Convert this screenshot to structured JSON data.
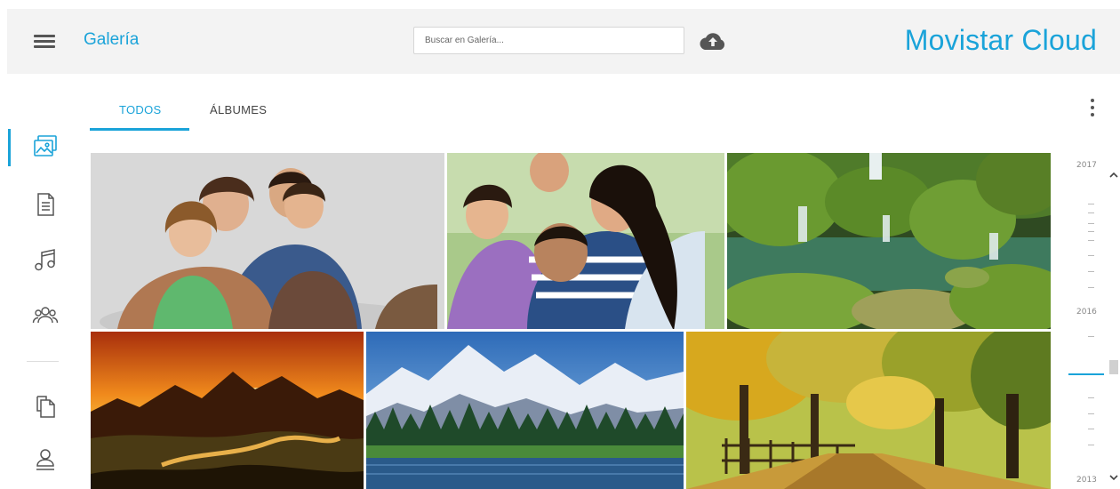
{
  "header": {
    "section_title": "Galería",
    "search_placeholder": "Buscar en Galería...",
    "brand": "Movistar Cloud"
  },
  "tabs": [
    {
      "label": "TODOS",
      "active": true
    },
    {
      "label": "ÁLBUMES",
      "active": false
    }
  ],
  "sidebar": {
    "items": [
      {
        "icon": "gallery-icon",
        "active": true
      },
      {
        "icon": "document-icon",
        "active": false
      },
      {
        "icon": "music-icon",
        "active": false
      },
      {
        "icon": "contacts-icon",
        "active": false
      },
      {
        "icon": "copy-icon",
        "active": false
      },
      {
        "icon": "user-icon",
        "active": false
      }
    ]
  },
  "gallery": {
    "photos": [
      {
        "subject": "family-portrait"
      },
      {
        "subject": "family-playing"
      },
      {
        "subject": "mossy-waterfall"
      },
      {
        "subject": "sunset-canyon"
      },
      {
        "subject": "snowy-mountains-lake"
      },
      {
        "subject": "autumn-park-path"
      }
    ]
  },
  "timeline": {
    "years": [
      "2017",
      "2016",
      "2013"
    ]
  },
  "colors": {
    "accent": "#1aa3d9",
    "header_bg": "#f3f3f3",
    "icon_gray": "#555555"
  }
}
